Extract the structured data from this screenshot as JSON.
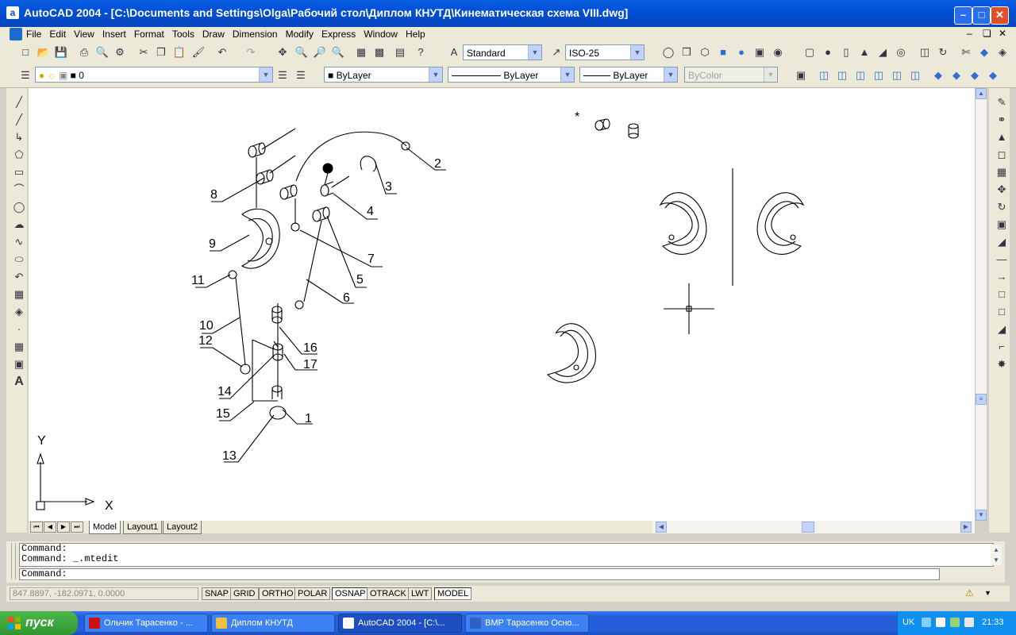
{
  "window": {
    "title": "AutoCAD 2004 - [C:\\Documents and Settings\\Olga\\Рабочий стол\\Диплом КНУТД\\Кинематическая схема VIII.dwg]",
    "app_icon": "a"
  },
  "menu": [
    "File",
    "Edit",
    "View",
    "Insert",
    "Format",
    "Tools",
    "Draw",
    "Dimension",
    "Modify",
    "Express",
    "Window",
    "Help"
  ],
  "toolbar_std": {
    "text_style": "Standard",
    "dim_style": "ISO-25"
  },
  "toolbar_props": {
    "layer": "0",
    "color": "ByLayer",
    "linetype": "ByLayer",
    "lineweight": "ByLayer",
    "plotstyle": "ByColor"
  },
  "drawing": {
    "callouts": [
      "1",
      "2",
      "3",
      "4",
      "5",
      "6",
      "7",
      "8",
      "9",
      "10",
      "11",
      "12",
      "13",
      "14",
      "15",
      "16",
      "17"
    ],
    "ucs_x": "X",
    "ucs_y": "Y"
  },
  "tabs": [
    "Model",
    "Layout1",
    "Layout2"
  ],
  "command": {
    "history": [
      "Command:",
      "Command: _.mtedit"
    ],
    "prompt": "Command:"
  },
  "status": {
    "coords": "847.8897, -182.0971, 0.0000",
    "toggles": [
      {
        "label": "SNAP",
        "on": false
      },
      {
        "label": "GRID",
        "on": false
      },
      {
        "label": "ORTHO",
        "on": false
      },
      {
        "label": "POLAR",
        "on": false
      },
      {
        "label": "OSNAP",
        "on": true
      },
      {
        "label": "OTRACK",
        "on": false
      },
      {
        "label": "LWT",
        "on": false
      },
      {
        "label": "MODEL",
        "on": true
      }
    ]
  },
  "taskbar": {
    "start": "пуск",
    "tasks": [
      {
        "label": "Ольчик Тарасенко - ...",
        "icon": "opera-icon",
        "color": "#cc1111",
        "active": false
      },
      {
        "label": "Диплом КНУТД",
        "icon": "folder-icon",
        "color": "#f0c040",
        "active": false
      },
      {
        "label": "AutoCAD 2004 - [C:\\...",
        "icon": "autocad-icon",
        "color": "#ffffff",
        "active": true
      },
      {
        "label": "ВМР Тарасенко Осно...",
        "icon": "word-icon",
        "color": "#3060c0",
        "active": false
      }
    ],
    "language": "UK",
    "clock": "21:33"
  }
}
